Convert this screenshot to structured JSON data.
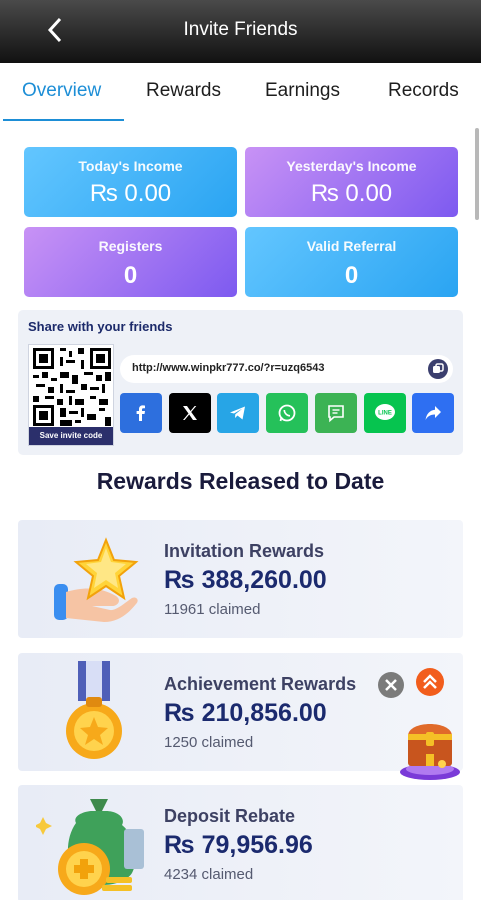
{
  "header": {
    "title": "Invite Friends",
    "back_icon": "chevron-left-icon"
  },
  "tabs": [
    {
      "label": "Overview",
      "active": true
    },
    {
      "label": "Rewards"
    },
    {
      "label": "Earnings"
    },
    {
      "label": "Records"
    }
  ],
  "stats": [
    {
      "label": "Today's Income",
      "value": "₨ 0.00"
    },
    {
      "label": "Yesterday's Income",
      "value": "₨ 0.00"
    },
    {
      "label": "Registers",
      "value": "0"
    },
    {
      "label": "Valid Referral",
      "value": "0"
    }
  ],
  "share": {
    "title": "Share with your friends",
    "qr_caption": "Save invite code",
    "link": "http://www.winpkr777.co/?r=uzq6543",
    "buttons": [
      {
        "icon": "facebook-icon",
        "color": "#2d6fde"
      },
      {
        "icon": "x-icon",
        "color": "#000000"
      },
      {
        "icon": "telegram-icon",
        "color": "#27a5e6"
      },
      {
        "icon": "whatsapp-icon",
        "color": "#25c15a"
      },
      {
        "icon": "message-icon",
        "color": "#3cb354"
      },
      {
        "icon": "line-icon",
        "color": "#06c44f"
      },
      {
        "icon": "share-icon",
        "color": "#2e6ff2"
      }
    ]
  },
  "rewards_section": {
    "title": "Rewards Released to Date",
    "items": [
      {
        "name": "Invitation Rewards",
        "amount": "₨ 388,260.00",
        "claimed": "11961 claimed",
        "icon": "star-hand-icon"
      },
      {
        "name": "Achievement Rewards",
        "amount": "₨ 210,856.00",
        "claimed": "1250 claimed",
        "icon": "medal-icon"
      },
      {
        "name": "Deposit Rebate",
        "amount": "₨ 79,956.96",
        "claimed": "4234 claimed",
        "icon": "money-bag-icon"
      }
    ]
  },
  "floating": {
    "close_icon": "close-icon",
    "up_icon": "double-chevron-up-icon",
    "chest_icon": "treasure-chest-icon"
  },
  "colors": {
    "accent": "#1d8ed6",
    "title": "#1a1b3c",
    "amount": "#1b2a6e"
  }
}
